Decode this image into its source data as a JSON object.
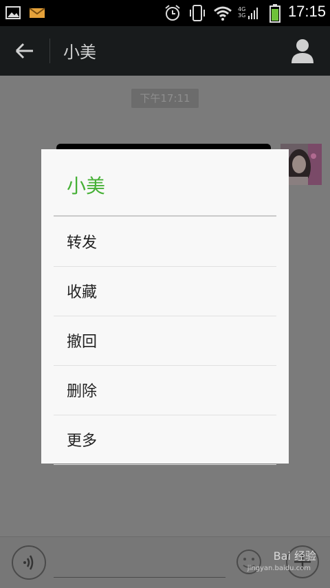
{
  "status_bar": {
    "time": "17:15",
    "network_top": "4G",
    "network_bottom": "3G"
  },
  "app_bar": {
    "title": "小美"
  },
  "chat": {
    "timestamp": "下午17:11"
  },
  "dialog": {
    "title": "小美",
    "items": [
      "转发",
      "收藏",
      "撤回",
      "删除",
      "更多"
    ]
  },
  "watermark": {
    "text": "Bai 经验",
    "url": "jingyan.baidu.com"
  },
  "colors": {
    "accent_green": "#45b035",
    "app_bar": "#181b1c",
    "overlay": "#7b7b7b"
  }
}
